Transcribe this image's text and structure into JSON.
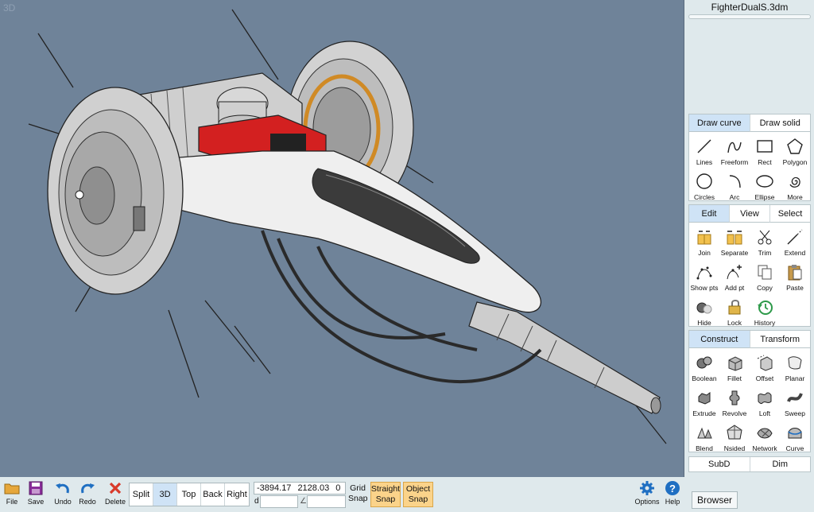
{
  "viewport": {
    "label": "3D"
  },
  "file": {
    "title": "FighterDualS.3dm"
  },
  "draw_panel": {
    "tabs": [
      "Draw curve",
      "Draw solid"
    ],
    "tools": [
      "Lines",
      "Freeform",
      "Rect",
      "Polygon",
      "Circles",
      "Arc",
      "Ellipse",
      "More"
    ]
  },
  "edit_panel": {
    "tabs": [
      "Edit",
      "View",
      "Select"
    ],
    "tools": [
      "Join",
      "Separate",
      "Trim",
      "Extend",
      "Show pts",
      "Add pt",
      "Copy",
      "Paste",
      "Hide",
      "Lock",
      "History"
    ]
  },
  "construct_panel": {
    "tabs": [
      "Construct",
      "Transform"
    ],
    "tools": [
      "Boolean",
      "Fillet",
      "Offset",
      "Planar",
      "Extrude",
      "Revolve",
      "Loft",
      "Sweep",
      "Blend",
      "Nsided",
      "Network",
      "Curve"
    ]
  },
  "bottom_tabs": [
    "SubD",
    "Dim"
  ],
  "browser_label": "Browser",
  "toolbar": {
    "file": "File",
    "save": "Save",
    "undo": "Undo",
    "redo": "Redo",
    "delete": "Delete",
    "views": [
      "Split",
      "3D",
      "Top",
      "Back",
      "Right"
    ],
    "active_view": "3D",
    "coord_x": "-3894.17",
    "coord_y": "2128.03",
    "coord_z": "0",
    "dist_label": "d",
    "angle_label": "∠",
    "grid_snap_1": "Grid",
    "grid_snap_2": "Snap",
    "straight_snap_1": "Straight",
    "straight_snap_2": "Snap",
    "object_snap_1": "Object",
    "object_snap_2": "Snap",
    "options": "Options",
    "help": "Help"
  },
  "colors": {
    "viewport_bg": "#6f8399",
    "panel_bg": "#dfe9ec",
    "active_tab": "#cfe3f6",
    "snap_active": "#fbd38a",
    "accent_blue": "#1f6fc2"
  }
}
